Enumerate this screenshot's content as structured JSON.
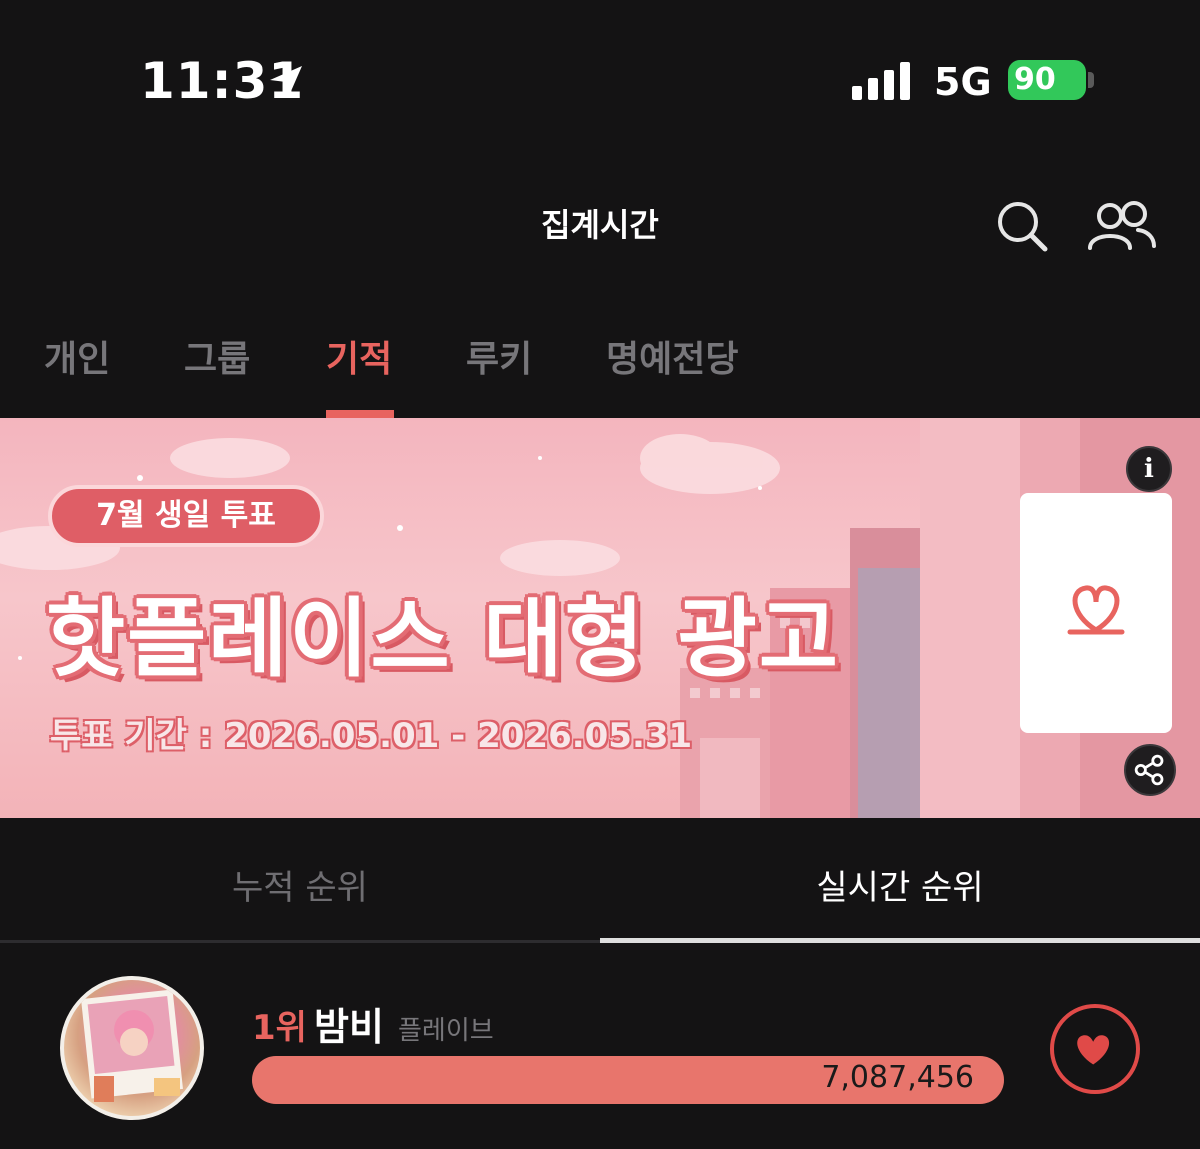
{
  "status_bar": {
    "time": "11:31",
    "network": "5G",
    "battery": "90"
  },
  "header": {
    "title": "집계시간"
  },
  "category_tabs": [
    {
      "label": "개인",
      "active": false
    },
    {
      "label": "그룹",
      "active": false
    },
    {
      "label": "기적",
      "active": true
    },
    {
      "label": "루키",
      "active": false
    },
    {
      "label": "명예전당",
      "active": false
    }
  ],
  "banner": {
    "badge": "7월 생일 투표",
    "headline": "핫플레이스 대형 광고",
    "period": "투표 기간 : 2026.05.01 - 2026.05.31"
  },
  "ranking_tabs": [
    {
      "label": "누적 순위",
      "active": false
    },
    {
      "label": "실시간 순위",
      "active": true
    }
  ],
  "ranking": [
    {
      "rank": "1위",
      "name": "밤비",
      "group": "플레이브",
      "votes": "7,087,456",
      "bar_fill_percent": 100
    }
  ],
  "colors": {
    "accent": "#e8645f",
    "background": "#141314",
    "bar": "#e8756c"
  }
}
